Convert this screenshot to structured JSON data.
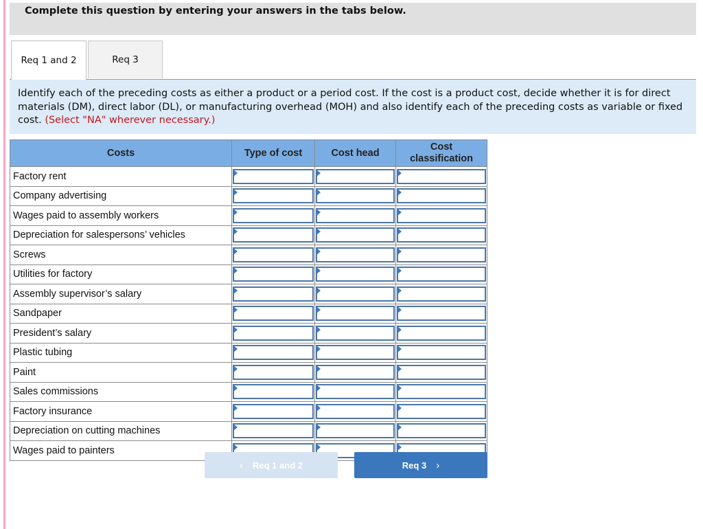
{
  "header": {
    "title": "Complete this question by entering your answers in the tabs below."
  },
  "tabs": [
    {
      "label": "Req 1 and 2",
      "active": true
    },
    {
      "label": "Req 3",
      "active": false
    }
  ],
  "instructions": {
    "text": "Identify each of the preceding costs as either a product or a period cost. If the cost is a product cost, decide whether it is for direct materials (DM), direct labor (DL), or manufacturing overhead (MOH) and also identify each of the preceding costs as variable or fixed cost.",
    "note": "(Select \"NA\" wherever necessary.)"
  },
  "table": {
    "headers": [
      "Costs",
      "Type of cost",
      "Cost head",
      "Cost classification"
    ],
    "rows": [
      {
        "cost": "Factory rent",
        "type": "",
        "head": "",
        "classification": ""
      },
      {
        "cost": "Company advertising",
        "type": "",
        "head": "",
        "classification": ""
      },
      {
        "cost": "Wages paid to assembly workers",
        "type": "",
        "head": "",
        "classification": ""
      },
      {
        "cost": "Depreciation for salespersons’ vehicles",
        "type": "",
        "head": "",
        "classification": ""
      },
      {
        "cost": "Screws",
        "type": "",
        "head": "",
        "classification": ""
      },
      {
        "cost": "Utilities for factory",
        "type": "",
        "head": "",
        "classification": ""
      },
      {
        "cost": "Assembly supervisor’s salary",
        "type": "",
        "head": "",
        "classification": ""
      },
      {
        "cost": "Sandpaper",
        "type": "",
        "head": "",
        "classification": ""
      },
      {
        "cost": "President’s salary",
        "type": "",
        "head": "",
        "classification": ""
      },
      {
        "cost": "Plastic tubing",
        "type": "",
        "head": "",
        "classification": ""
      },
      {
        "cost": "Paint",
        "type": "",
        "head": "",
        "classification": ""
      },
      {
        "cost": "Sales commissions",
        "type": "",
        "head": "",
        "classification": ""
      },
      {
        "cost": "Factory insurance",
        "type": "",
        "head": "",
        "classification": ""
      },
      {
        "cost": "Depreciation on cutting machines",
        "type": "",
        "head": "",
        "classification": ""
      },
      {
        "cost": "Wages paid to painters",
        "type": "",
        "head": "",
        "classification": ""
      }
    ]
  },
  "nav": {
    "prev_label": "Req 1 and 2",
    "prev_icon": "‹",
    "next_label": "Req 3",
    "next_icon": "›"
  }
}
